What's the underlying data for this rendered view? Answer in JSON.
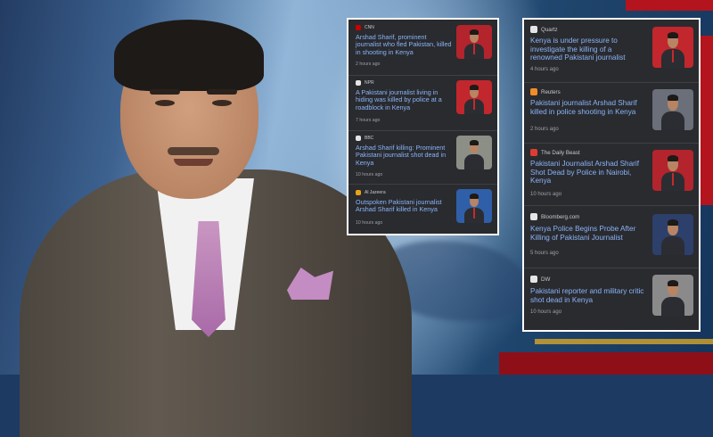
{
  "colors": {
    "panel_bg": "#2a2b2f",
    "headline": "#8ab4f8",
    "meta": "#9aa0a6",
    "border": "#ffffff"
  },
  "left_panel": {
    "items": [
      {
        "source": "CNN",
        "logo_color": "#cc0000",
        "title": "Arshad Sharif, prominent journalist who fled Pakistan, killed in shooting in Kenya",
        "time": "2 hours ago",
        "thumb_bg": "#b3242c"
      },
      {
        "source": "NPR",
        "logo_color": "#e5e5e5",
        "title": "A Pakistani journalist living in hiding was killed by police at a roadblock in Kenya",
        "time": "7 hours ago",
        "thumb_bg": "#c1272d"
      },
      {
        "source": "BBC",
        "logo_color": "#e5e5e5",
        "title": "Arshad Sharif killing: Prominent Pakistani journalist shot dead in Kenya",
        "time": "10 hours ago",
        "thumb_bg": "#8c8f86"
      },
      {
        "source": "Al Jazeera",
        "logo_color": "#e8a317",
        "title": "Outspoken Pakistani journalist Arshad Sharif killed in Kenya",
        "time": "10 hours ago",
        "thumb_bg": "#2f5fa8"
      }
    ]
  },
  "right_panel": {
    "items": [
      {
        "source": "Quartz",
        "logo_color": "#e5e5e5",
        "title": "Kenya is under pressure to investigate the killing of a renowned Pakistani journalist",
        "time": "4 hours ago",
        "thumb_bg": "#c1272d"
      },
      {
        "source": "Reuters",
        "logo_color": "#f28c28",
        "title": "Pakistani journalist Arshad Sharif killed in police shooting in Kenya",
        "time": "2 hours ago",
        "thumb_bg": "#6b6f7a"
      },
      {
        "source": "The Daily Beast",
        "logo_color": "#e03c31",
        "title": "Pakistani Journalist Arshad Sharif Shot Dead by Police in Nairobi, Kenya",
        "time": "10 hours ago",
        "thumb_bg": "#b3242c"
      },
      {
        "source": "Bloomberg.com",
        "logo_color": "#e5e5e5",
        "title": "Kenya Police Begins Probe After Killing of Pakistani Journalist",
        "time": "5 hours ago",
        "thumb_bg": "#2d3f6b"
      },
      {
        "source": "DW",
        "logo_color": "#e5e5e5",
        "title": "Pakistani reporter and military critic shot dead in Kenya",
        "time": "10 hours ago",
        "thumb_bg": "#8a8a8a"
      }
    ]
  }
}
